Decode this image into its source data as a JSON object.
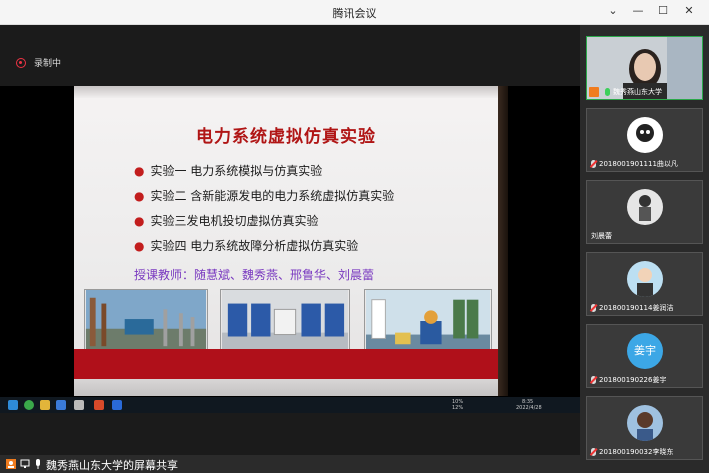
{
  "window": {
    "title": "腾讯会议",
    "min_label": "—",
    "max_label": "☐",
    "close_label": "✕",
    "more_label": "⌄"
  },
  "recording": {
    "label": "录制中"
  },
  "slide": {
    "title": "电力系统虚拟仿真实验",
    "experiments": [
      "实验一  电力系统模拟与仿真实验",
      "实验二  含新能源发电的电力系统虚拟仿真实验",
      "实验三发电机投切虚拟仿真实验",
      "实验四  电力系统故障分析虚拟仿真实验"
    ],
    "teachers": "授课教师：随慧斌、魏秀燕、邢鲁华、刘晨蕾"
  },
  "taskbar": {
    "time": "8:35",
    "date": "2022/4/28",
    "net": "10%",
    "net2": "12%",
    "cpu": "CPU利用"
  },
  "share": {
    "label": "魏秀燕山东大学的屏幕共享"
  },
  "participants": [
    {
      "name": "魏秀燕山东大学",
      "active": true,
      "mic": "on"
    },
    {
      "name": "2018001901111曲以凡",
      "mic": "off"
    },
    {
      "name": "刘晨蕾",
      "mic": "none"
    },
    {
      "name": "201800190114姜润洁",
      "mic": "off"
    },
    {
      "name": "201800190226姜宇",
      "mic": "off",
      "avatar_text": "姜宇"
    },
    {
      "name": "201800190032李晓东",
      "mic": "off"
    }
  ],
  "colors": {
    "accent": "#b01515",
    "active_border": "#2ba84a",
    "teacher_text": "#7a3ac0"
  }
}
